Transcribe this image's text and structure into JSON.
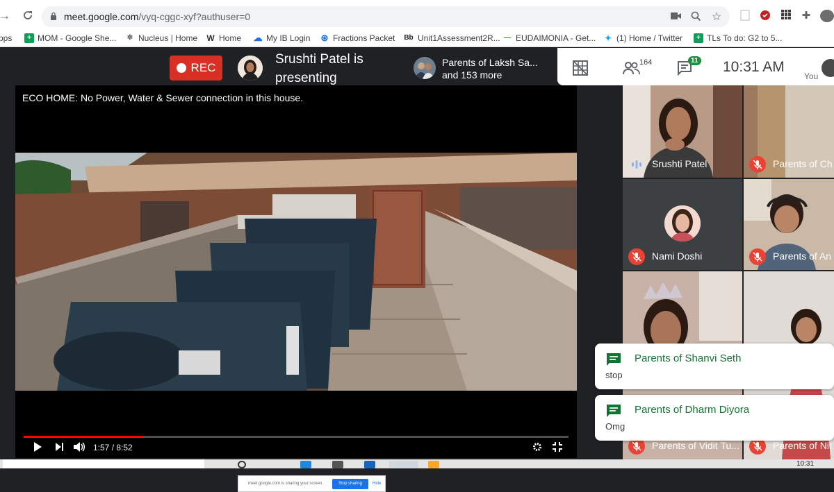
{
  "browser": {
    "url_host": "meet.google.com",
    "url_path": "/vyq-cggc-xyf?authuser=0",
    "bookmarks": [
      {
        "label": "pps",
        "icon": "apps-icon"
      },
      {
        "label": "MOM - Google She...",
        "icon": "sheets-icon"
      },
      {
        "label": "Nucleus | Home",
        "icon": "nucleus-icon"
      },
      {
        "label": "Home",
        "icon": "w-icon"
      },
      {
        "label": "My IB Login",
        "icon": "cloud-icon"
      },
      {
        "label": "Fractions Packet",
        "icon": "fractions-icon"
      },
      {
        "label": "Unit1Assessment2R...",
        "icon": "bb-icon"
      },
      {
        "label": "EUDAIMONIA - Get...",
        "icon": "dash-icon"
      },
      {
        "label": "(1) Home / Twitter",
        "icon": "twitter-icon"
      },
      {
        "label": "TLs To do: G2 to 5...",
        "icon": "sheets-icon"
      }
    ]
  },
  "meet": {
    "rec_label": "REC",
    "presenter_line1": "Srushti Patel is",
    "presenter_line2": "presenting",
    "raise_line1": "Parents of Laksh Sa...",
    "raise_line2": "and 153 more",
    "participants_count": "164",
    "chat_count": "11",
    "clock": "10:31 AM",
    "you_label": "You"
  },
  "video": {
    "title": "ECO HOME: No Power, Water & Sewer connection in this house.",
    "time": "1:57 / 8:52",
    "progress": 0.22
  },
  "share_banner": {
    "message": "meet.google.com is sharing your screen.",
    "stop_label": "Stop sharing",
    "hide_label": "Hide"
  },
  "tiles": [
    {
      "name": "Srushti Patel",
      "state": "speaking"
    },
    {
      "name": "Parents of Ch",
      "state": "muted"
    },
    {
      "name": "Nami Doshi",
      "state": "muted"
    },
    {
      "name": "Parents of An",
      "state": "muted"
    },
    {
      "name": "Parents of Vidit Tu...",
      "state": "muted"
    },
    {
      "name": "Parents of Nit",
      "state": "muted"
    }
  ],
  "chat_toasts": [
    {
      "sender": "Parents of Shanvi Seth",
      "message": "stop"
    },
    {
      "sender": "Parents of Dharm Diyora",
      "message": "Omg"
    }
  ],
  "taskbar": {
    "clock": "10:31"
  },
  "colors": {
    "meet_bg": "#202124",
    "rec_red": "#d93025",
    "chat_green": "#137333",
    "badge_green": "#1e8e3e",
    "progress_red": "#ff0000"
  }
}
